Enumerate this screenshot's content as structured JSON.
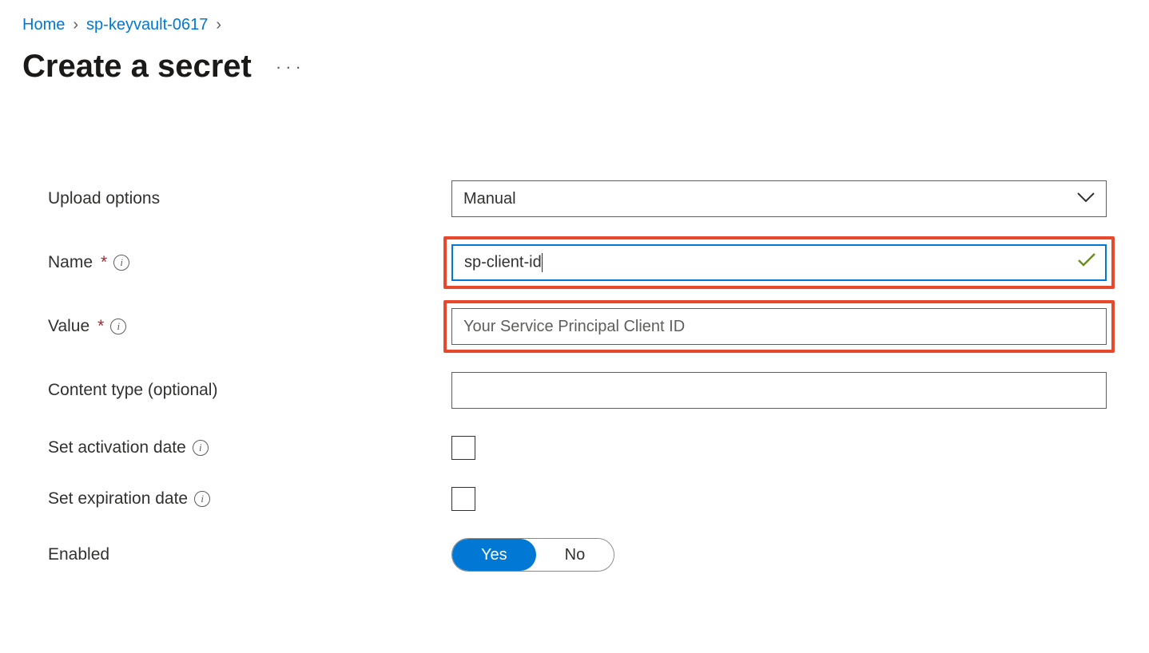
{
  "breadcrumb": {
    "home": "Home",
    "resource": "sp-keyvault-0617"
  },
  "title": "Create a secret",
  "form": {
    "upload_options": {
      "label": "Upload options",
      "value": "Manual"
    },
    "name": {
      "label": "Name",
      "value": "sp-client-id"
    },
    "value": {
      "label": "Value",
      "placeholder": "Your Service Principal Client ID"
    },
    "content_type": {
      "label": "Content type (optional)",
      "value": ""
    },
    "activation": {
      "label": "Set activation date"
    },
    "expiration": {
      "label": "Set expiration date"
    },
    "enabled": {
      "label": "Enabled",
      "yes": "Yes",
      "no": "No"
    }
  }
}
